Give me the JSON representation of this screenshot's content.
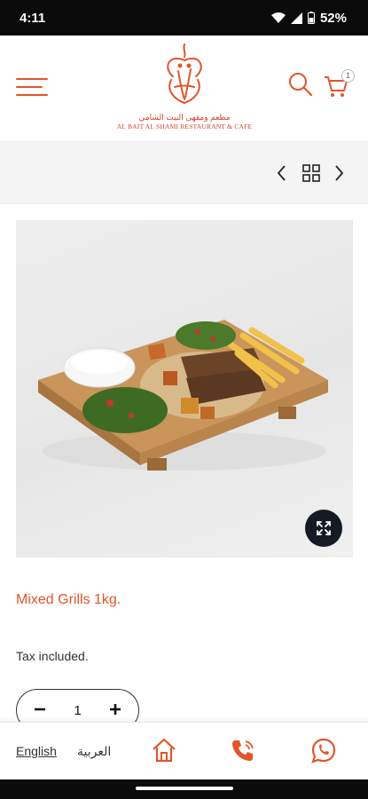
{
  "status_bar": {
    "time": "4:11",
    "battery": "52%"
  },
  "header": {
    "logo_name_en": "AL BAIT AL SHAMI RESTAURANT & CAFE",
    "logo_name_ar": "مطعم ومقهى البيت الشامي",
    "cart_count": "1"
  },
  "product": {
    "title": "Mixed Grills 1kg.",
    "tax_note": "Tax included.",
    "quantity": "1"
  },
  "bottom_bar": {
    "lang_english": "English",
    "lang_arabic": "العربية"
  },
  "colors": {
    "accent": "#e2552a",
    "status_bar": "#0b0b0b",
    "zoom_button": "#141b24"
  },
  "icons": [
    "hamburger-icon",
    "search-icon",
    "cart-icon",
    "chevron-left-icon",
    "grid-icon",
    "chevron-right-icon",
    "expand-icon",
    "minus-icon",
    "plus-icon",
    "home-icon",
    "phone-icon",
    "whatsapp-icon"
  ]
}
